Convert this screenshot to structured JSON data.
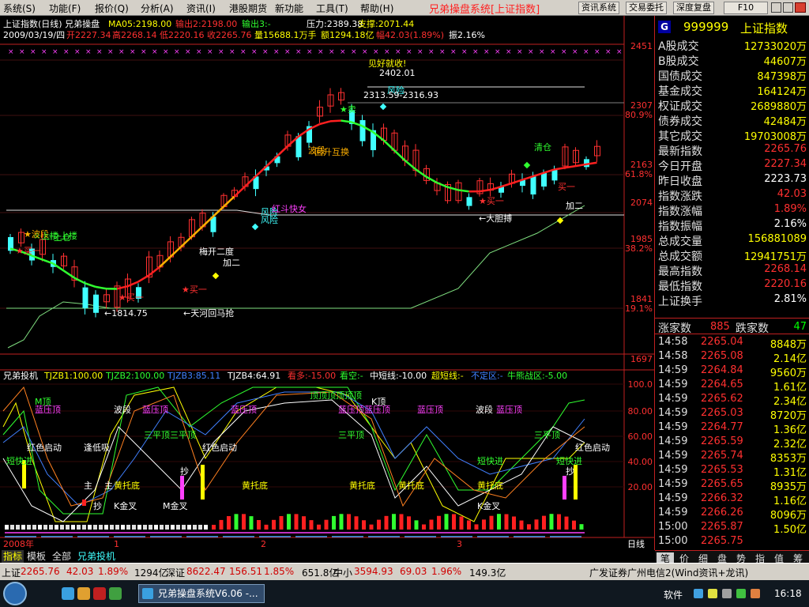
{
  "app": {
    "title": "兄弟操盘系统[上证指数]",
    "menu": [
      "系统(S)",
      "功能(F)",
      "报价(Q)",
      "分析(A)",
      "资讯(I)",
      "港股期货",
      "新功能",
      "工具(T)",
      "帮助(H)"
    ],
    "toolbar_buttons": [
      "资讯系统",
      "交易委托",
      "深度复盘",
      "F10"
    ]
  },
  "main_chart": {
    "header_line1": [
      "上证指数(日线) 兄弟操盘",
      "MA05:2198.00",
      "输出2:2198.00",
      "输出3:-",
      "压力:2389.38",
      "支撑:2071.44"
    ],
    "header_line2": [
      "2009/03/19/四",
      "开2227.34",
      "高2268.14",
      "低2220.16",
      "收2265.76",
      "量15688.1万手",
      "额1294.18亿",
      "幅42.03(1.89%)",
      "振2.16%"
    ],
    "y_axis_ticks": [
      "2451",
      "2307",
      "80.9%",
      "2163",
      "61.8%",
      "2074",
      "1985",
      "38.2%",
      "1841",
      "19.1%",
      "1697"
    ],
    "annotations": [
      "见好就收!",
      "2402.01",
      "风险",
      "2313.59-2316.93",
      "★卖",
      "波段",
      "回升互换",
      "风险",
      "红斗快女",
      "风险",
      "梅开二度",
      "加二",
      "★买一",
      "★买一",
      "★买一",
      "★买一",
      "★波段",
      "☆上楼",
      "☆上楼",
      "☆上仓",
      "买一",
      "←1814.75",
      "←天河回马抢",
      "←大胆搏",
      "清仓",
      "加二"
    ]
  },
  "indicator_chart": {
    "header": [
      "兄弟投机",
      "TJZB1:100.00",
      "TJZB2:100.00",
      "TJZB3:85.11",
      "TJZB4:64.91",
      "看多:-15.00",
      "看空:-",
      "中短线:-10.00",
      "超短线:-",
      "不定区:-",
      "牛熊战区:-5.00"
    ],
    "y_axis_ticks": [
      "100.0",
      "80.00",
      "60.00",
      "40.00",
      "20.00"
    ],
    "labels": [
      "M顶",
      "蓝压顶",
      "波段",
      "蓝压顶",
      "蓝压顶",
      "顶顶顶顶顶顶",
      "K顶",
      "蓝压顶蓝压顶",
      "蓝压顶",
      "波段",
      "蓝压顶",
      "三平顶三平顶",
      "三平顶",
      "三平顶",
      "红色启动",
      "逢低吸",
      "红色启动",
      "短快进",
      "短快进",
      "短快进",
      "红色启动",
      "主",
      "主",
      "抄",
      "黄托底",
      "黄托底",
      "黄托底",
      "黄托底",
      "黄托底",
      "K金叉",
      "M金叉",
      "K金叉",
      "抄",
      "抄"
    ]
  },
  "time_axis": {
    "labels": [
      "2008年",
      "1",
      "2",
      "3"
    ],
    "period": "日线"
  },
  "chart_tabs": [
    "指标",
    "模板",
    "全部",
    "兄弟投机"
  ],
  "quote": {
    "code": "999999",
    "name": "上证指数",
    "rows": [
      {
        "label": "A股成交",
        "value": "12733020万",
        "color": "#ffff00"
      },
      {
        "label": "B股成交",
        "value": "44607万",
        "color": "#ffff00"
      },
      {
        "label": "国债成交",
        "value": "847398万",
        "color": "#ffff00"
      },
      {
        "label": "基金成交",
        "value": "164124万",
        "color": "#ffff00"
      },
      {
        "label": "权证成交",
        "value": "2689880万",
        "color": "#ffff00"
      },
      {
        "label": "债券成交",
        "value": "42484万",
        "color": "#ffff00"
      },
      {
        "label": "其它成交",
        "value": "19703008万",
        "color": "#ffff00"
      },
      {
        "label": "最新指数",
        "value": "2265.76",
        "color": "#ff3030"
      },
      {
        "label": "今日开盘",
        "value": "2227.34",
        "color": "#ff3030"
      },
      {
        "label": "昨日收盘",
        "value": "2223.73",
        "color": "#ffffff"
      },
      {
        "label": "指数涨跌",
        "value": "42.03",
        "color": "#ff3030"
      },
      {
        "label": "指数涨幅",
        "value": "1.89%",
        "color": "#ff3030"
      },
      {
        "label": "指数振幅",
        "value": "2.16%",
        "color": "#ffffff"
      },
      {
        "label": "总成交量",
        "value": "156881089",
        "color": "#ffff00"
      },
      {
        "label": "总成交额",
        "value": "12941751万",
        "color": "#ffff00"
      },
      {
        "label": "最高指数",
        "value": "2268.14",
        "color": "#ff3030"
      },
      {
        "label": "最低指数",
        "value": "2220.16",
        "color": "#ff3030"
      },
      {
        "label": "上证换手",
        "value": "2.81%",
        "color": "#ffffff"
      }
    ],
    "advance_label": "涨家数",
    "advance_count": "885",
    "decline_label": "跌家数",
    "decline_count": "47"
  },
  "ticks": [
    {
      "time": "14:58",
      "price": "2265.04",
      "vol": "8848万"
    },
    {
      "time": "14:58",
      "price": "2265.08",
      "vol": "2.14亿"
    },
    {
      "time": "14:59",
      "price": "2264.84",
      "vol": "9560万"
    },
    {
      "time": "14:59",
      "price": "2264.65",
      "vol": "1.61亿"
    },
    {
      "time": "14:59",
      "price": "2265.62",
      "vol": "2.34亿"
    },
    {
      "time": "14:59",
      "price": "2265.03",
      "vol": "8720万"
    },
    {
      "time": "14:59",
      "price": "2264.77",
      "vol": "1.36亿"
    },
    {
      "time": "14:59",
      "price": "2265.59",
      "vol": "2.32亿"
    },
    {
      "time": "14:59",
      "price": "2265.74",
      "vol": "8353万"
    },
    {
      "time": "14:59",
      "price": "2265.53",
      "vol": "1.31亿"
    },
    {
      "time": "14:59",
      "price": "2265.65",
      "vol": "8935万"
    },
    {
      "time": "14:59",
      "price": "2266.32",
      "vol": "1.16亿"
    },
    {
      "time": "14:59",
      "price": "2266.26",
      "vol": "8096万"
    },
    {
      "time": "15:00",
      "price": "2265.87",
      "vol": "1.50亿"
    },
    {
      "time": "15:00",
      "price": "2265.75",
      "vol": ""
    }
  ],
  "right_tabs": [
    "笔",
    "价",
    "细",
    "盘",
    "势",
    "指",
    "值",
    "筹"
  ],
  "ticker": {
    "sh_label": "上证",
    "sh_value": "2265.76",
    "sh_change": "42.03",
    "sh_pct": "1.89%",
    "sh_amount": "1294亿",
    "sz_label": "深证",
    "sz_value": "8622.47",
    "sz_change": "156.51",
    "sz_pct": "1.85%",
    "sz_amount": "651.8亿",
    "zx_label": "中小",
    "zx_value": "3594.93",
    "zx_change": "69.03",
    "zx_pct": "1.96%",
    "zx_amount": "149.3亿",
    "broker": "广发证券广州电信2(Wind资讯+龙讯)"
  },
  "taskbar": {
    "task": "兄弟操盘系统V6.06 -...",
    "tray_label": "软件",
    "clock": "16:18"
  },
  "colors": {
    "rise": "#ff3030",
    "fall": "#40ffff",
    "ma_up": "#ff2020",
    "ma_down": "#30ff30",
    "ma_mid": "#ffb000",
    "grid": "#c02020",
    "accent": "#ffff00"
  }
}
